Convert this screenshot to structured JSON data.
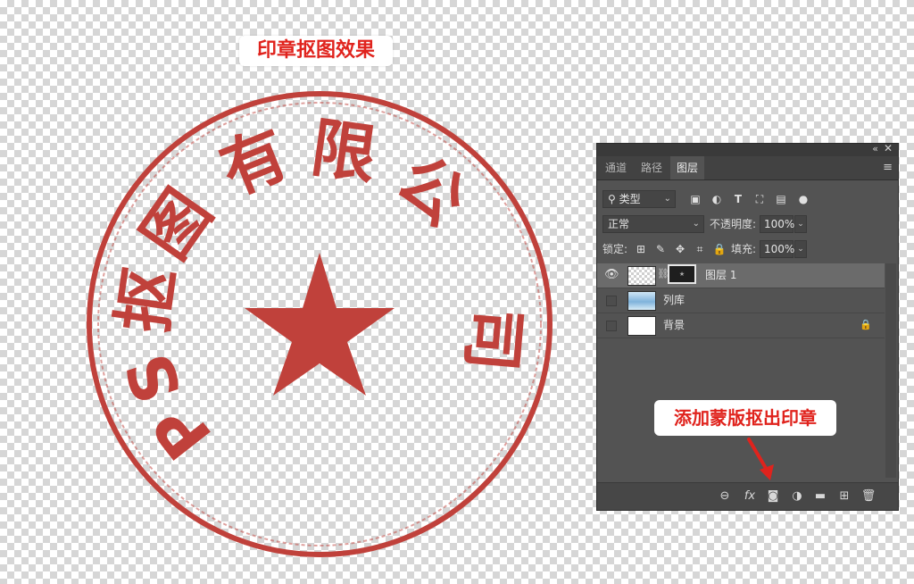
{
  "canvas": {
    "title_label": "印章抠图效果",
    "stamp": {
      "text": "PS抠图有限公司",
      "chars": [
        "P",
        "S",
        "抠",
        "图",
        "有",
        "限",
        "公",
        "司"
      ],
      "color": "#c0413b"
    }
  },
  "panel": {
    "tabs": [
      {
        "label": "通道"
      },
      {
        "label": "路径"
      },
      {
        "label": "图层"
      }
    ],
    "active_tab": "图层",
    "filter": {
      "kind_label": "类型"
    },
    "blend": {
      "mode": "正常",
      "opacity_label": "不透明度:",
      "opacity_value": "100%"
    },
    "lock": {
      "label": "锁定:",
      "fill_label": "填充:",
      "fill_value": "100%"
    },
    "layers": [
      {
        "name": "图层 1",
        "visible": true,
        "selected": true,
        "thumb": "transparent",
        "has_mask": true
      },
      {
        "name": "列库",
        "visible": false,
        "selected": false,
        "thumb": "photo"
      },
      {
        "name": "背景",
        "visible": false,
        "selected": false,
        "thumb": "white",
        "locked": true
      }
    ],
    "bottom_icons": [
      "link-icon",
      "fx-icon",
      "add-mask-icon",
      "adjustment-icon",
      "folder-icon",
      "new-layer-icon",
      "trash-icon"
    ]
  },
  "callout": {
    "text": "添加蒙版抠出印章",
    "color": "#e0231d"
  }
}
